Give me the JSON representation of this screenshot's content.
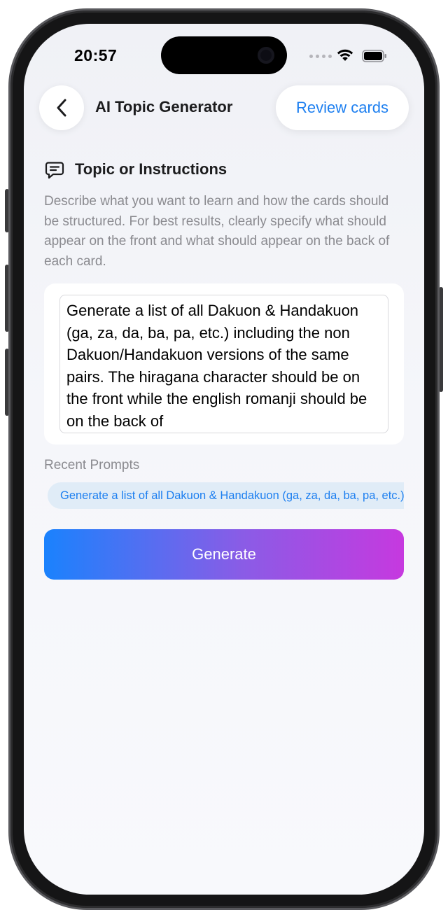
{
  "status_bar": {
    "time": "20:57",
    "icons": [
      "signal-dots-icon",
      "wifi-icon",
      "battery-icon"
    ]
  },
  "header": {
    "back_icon": "chevron-left-icon",
    "title": "AI Topic Generator",
    "review_label": "Review cards"
  },
  "section": {
    "icon": "message-icon",
    "title": "Topic or Instructions",
    "description": "Describe what you want to learn and how the cards should be structured. For best results, clearly specify what should appear on the front and what should appear on the back of each card."
  },
  "input": {
    "value": "Generate a list of all Dakuon & Handakuon (ga, za, da, ba, pa, etc.) including the non Dakuon/Handakuon versions of the same pairs. The hiragana character should be on the front while the english romanji should be on the back of"
  },
  "recent": {
    "label": "Recent Prompts",
    "chips": [
      "Generate a list of all Dakuon & Handakuon (ga, za, da, ba, pa, etc.) including the non Dakuon/Handakuon versions of the same pairs."
    ]
  },
  "generate_label": "Generate",
  "colors": {
    "accent": "#1d7ff0",
    "gradient_start": "#1a82fd",
    "gradient_end": "#c639df"
  }
}
